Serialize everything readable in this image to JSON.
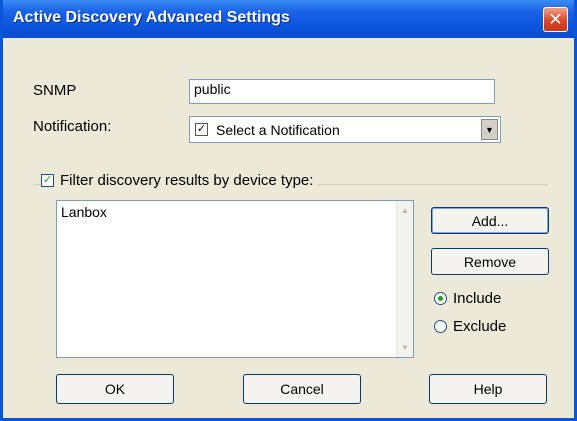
{
  "window": {
    "title": "Active Discovery Advanced Settings",
    "close_glyph": "✕"
  },
  "snmp": {
    "label": "SNMP",
    "value": "public"
  },
  "notification": {
    "label": "Notification:",
    "selected": "Select a Notification",
    "check_glyph": "✓",
    "arrow_glyph": "▼"
  },
  "filter": {
    "label": "Filter discovery results by device type:",
    "checked": true,
    "check_glyph": "✓"
  },
  "device_list": {
    "items": [
      "Lanbox"
    ],
    "scroll_up_glyph": "▲",
    "scroll_down_glyph": "▼"
  },
  "buttons": {
    "add": "Add...",
    "remove": "Remove",
    "ok": "OK",
    "cancel": "Cancel",
    "help": "Help"
  },
  "mode": {
    "include": "Include",
    "exclude": "Exclude",
    "selected": "include"
  }
}
